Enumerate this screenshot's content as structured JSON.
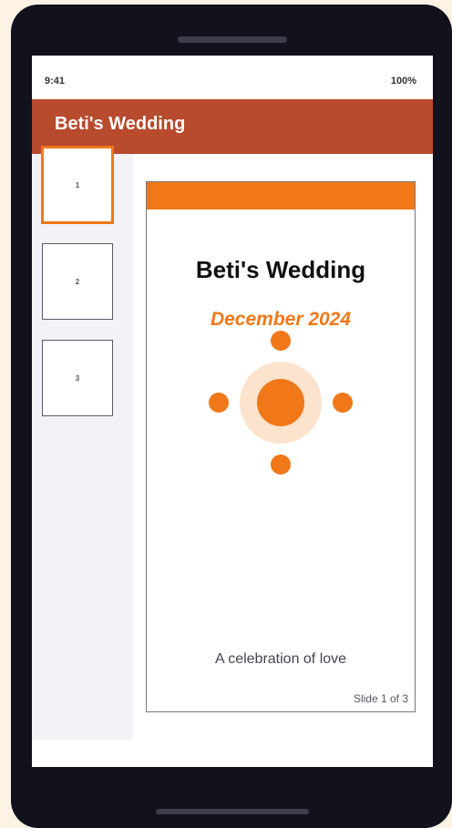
{
  "status_bar": {
    "time": "9:41",
    "battery": "100%"
  },
  "header": {
    "title": "Beti's Wedding"
  },
  "sidebar": {
    "thumbnails": [
      {
        "number": "1",
        "selected": true
      },
      {
        "number": "2",
        "selected": false
      },
      {
        "number": "3",
        "selected": false
      }
    ]
  },
  "slide": {
    "title": "Beti's Wedding",
    "date": "December 2024",
    "subtitle": "A celebration of love",
    "slide_number": "Slide 1 of 3"
  },
  "colors": {
    "header_bg": "#b84a2d",
    "accent": "#f07818",
    "halo": "#fbe3cd",
    "sidebar_bg": "#f2f2f7",
    "device_frame": "#12121d",
    "page_bg": "#fdf3e5"
  },
  "icons": {
    "decoration": "sun-motif-icon"
  }
}
